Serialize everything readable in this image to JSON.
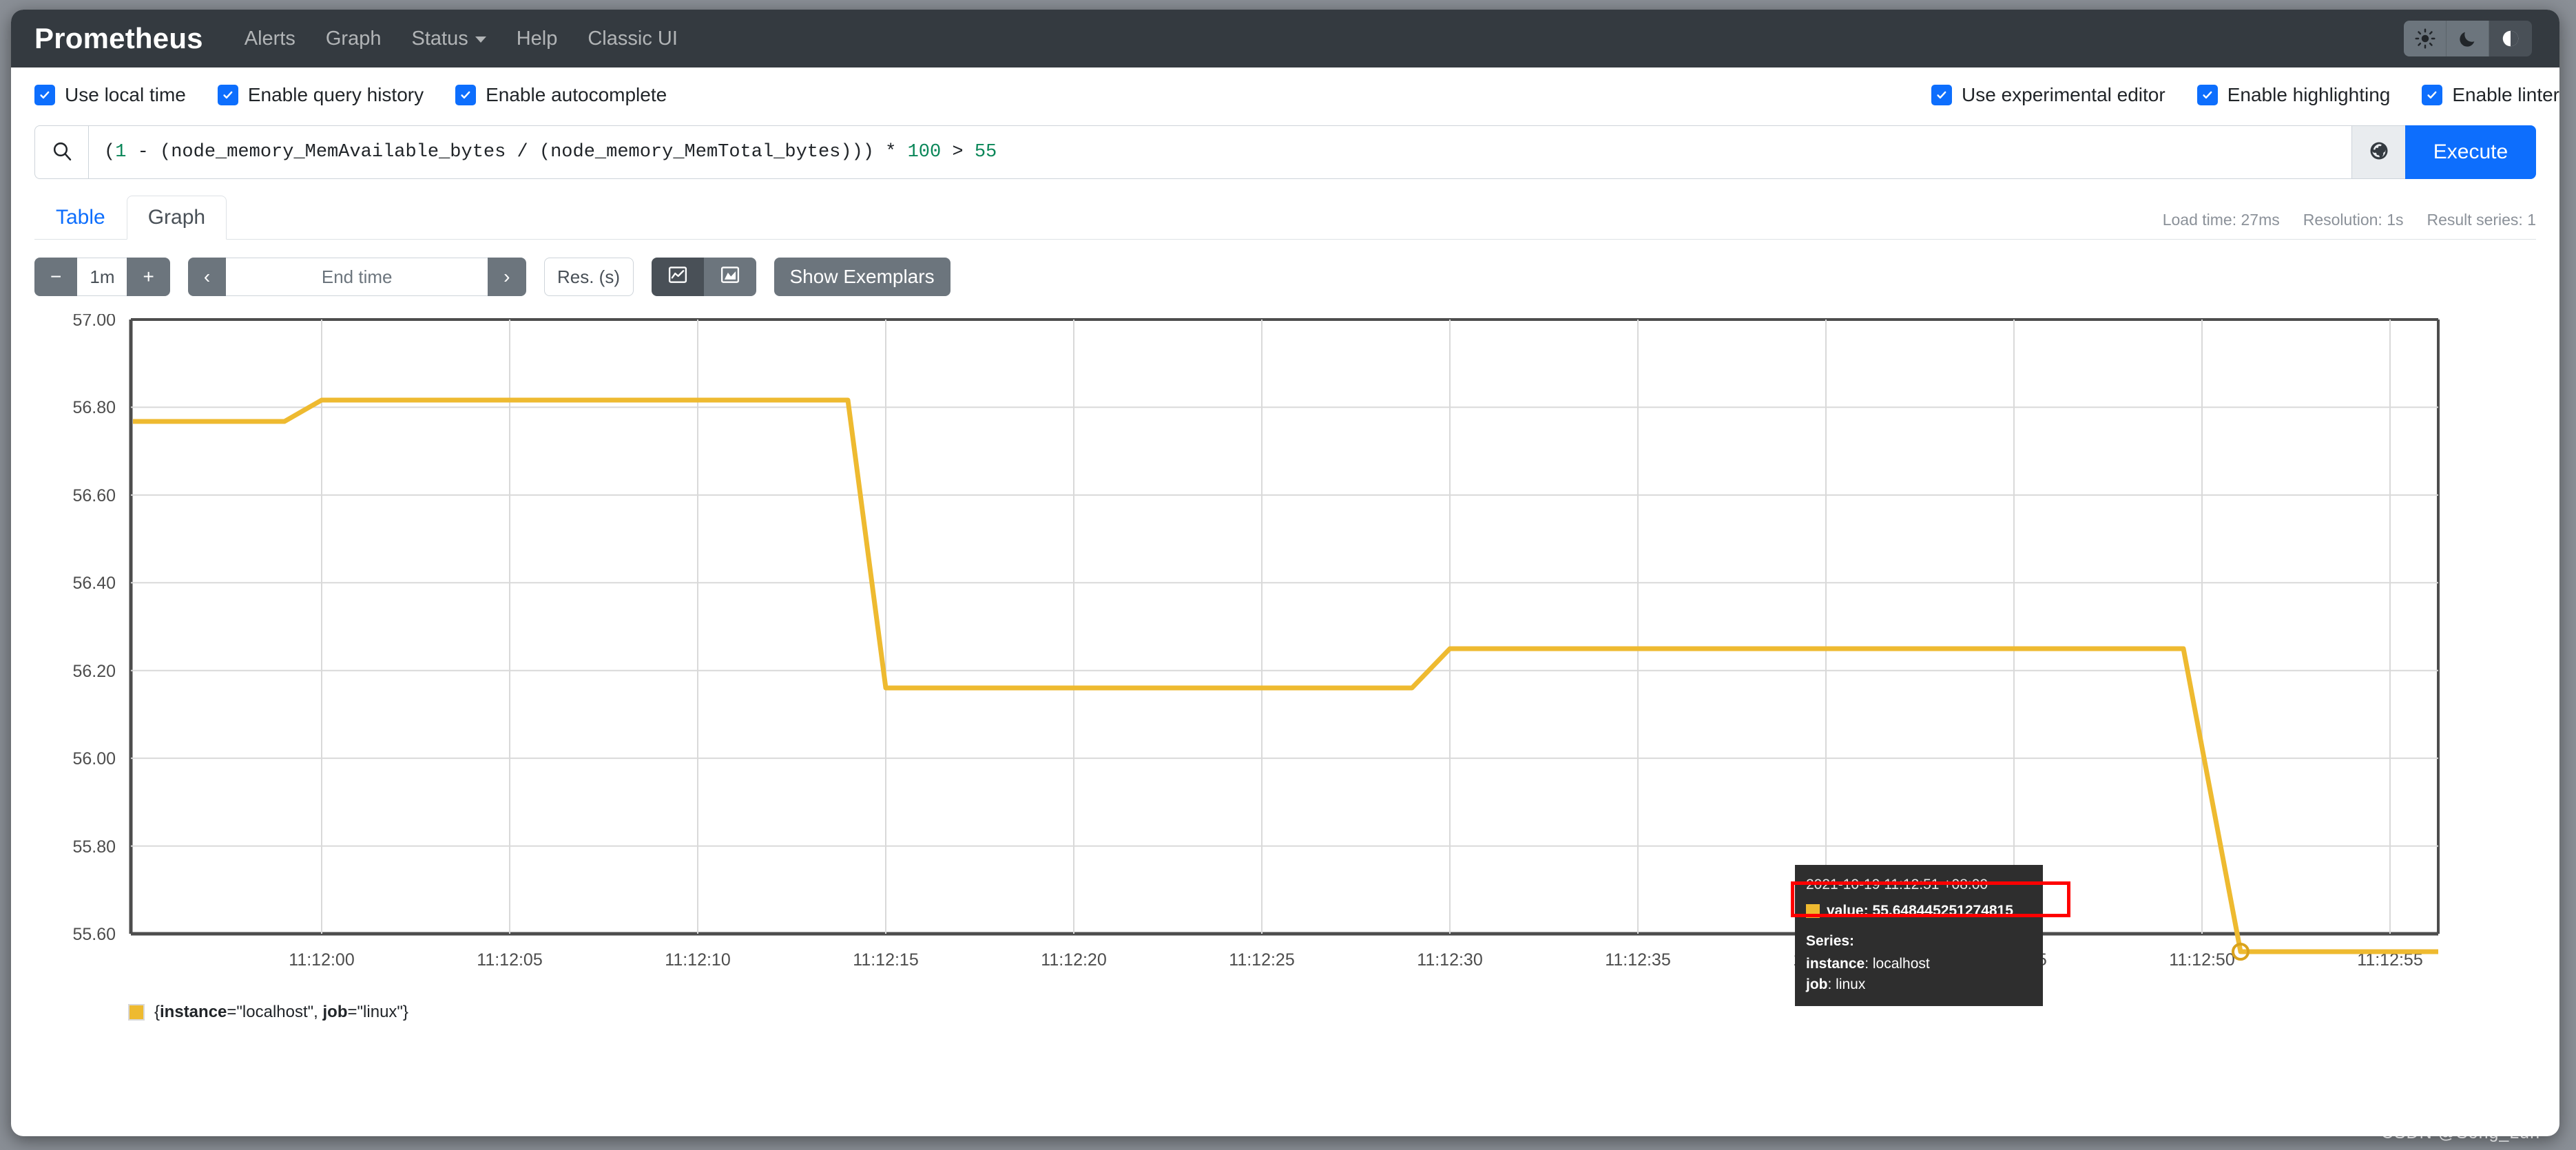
{
  "navbar": {
    "brand": "Prometheus",
    "links": [
      {
        "label": "Alerts",
        "name": "nav-alerts"
      },
      {
        "label": "Graph",
        "name": "nav-graph"
      },
      {
        "label": "Status",
        "name": "nav-status",
        "caret": true
      },
      {
        "label": "Help",
        "name": "nav-help"
      },
      {
        "label": "Classic UI",
        "name": "nav-classic-ui"
      }
    ],
    "theme_buttons": [
      {
        "icon": "sun-icon",
        "label": "Light theme"
      },
      {
        "icon": "moon-icon",
        "label": "Dark theme"
      },
      {
        "icon": "half-circle-icon",
        "label": "Auto theme",
        "active": true
      }
    ]
  },
  "settings": {
    "left": [
      {
        "label": "Use local time",
        "checked": true
      },
      {
        "label": "Enable query history",
        "checked": true
      },
      {
        "label": "Enable autocomplete",
        "checked": true
      }
    ],
    "right": [
      {
        "label": "Use experimental editor",
        "checked": true
      },
      {
        "label": "Enable highlighting",
        "checked": true
      },
      {
        "label": "Enable linter",
        "checked": true
      }
    ]
  },
  "query": {
    "search_icon": "search-icon",
    "history_icon": "globe-history-icon",
    "expression_parts": [
      {
        "t": "(",
        "k": "plain"
      },
      {
        "t": "1",
        "k": "num"
      },
      {
        "t": " - (node_memory_MemAvailable_bytes / (node_memory_MemTotal_bytes))) * ",
        "k": "plain"
      },
      {
        "t": "100",
        "k": "num"
      },
      {
        "t": " > ",
        "k": "plain"
      },
      {
        "t": "55",
        "k": "num"
      }
    ],
    "expression": "(1 - (node_memory_MemAvailable_bytes / (node_memory_MemTotal_bytes))) * 100 > 55",
    "execute_label": "Execute"
  },
  "tabs": [
    {
      "label": "Table",
      "active": false
    },
    {
      "label": "Graph",
      "active": true
    }
  ],
  "stats": [
    "Load time: 27ms",
    "Resolution: 1s",
    "Result series: 1"
  ],
  "controls": {
    "decrease_label": "−",
    "range_value": "1m",
    "increase_label": "+",
    "prev_label": "‹",
    "end_time_placeholder": "End time",
    "end_time_value": "",
    "next_label": "›",
    "resolution_placeholder": "Res. (s)",
    "resolution_value": "",
    "chart_type_line_icon": "line-chart-icon",
    "chart_type_stacked_icon": "stacked-area-icon",
    "show_exemplars_label": "Show Exemplars"
  },
  "legend": {
    "swatch_color": "#eeba30",
    "prefix": "{",
    "key1": "instance",
    "val1": "=\"localhost\", ",
    "key2": "job",
    "val2": "=\"linux\"}",
    "full": "{instance=\"localhost\", job=\"linux\"}"
  },
  "tooltip": {
    "timestamp": "2021-10-19 11:12:51 +08:00",
    "value_label": "value: 55.648445251274815",
    "series_header": "Series:",
    "instance_key": "instance",
    "instance_val": ": localhost",
    "job_key": "job",
    "job_val": ": linux",
    "swatch_color": "#eeba30",
    "highlight_color": "#ff0000"
  },
  "watermark": "CSDN @Song_Lun",
  "chart_data": {
    "type": "line",
    "title": "",
    "xlabel": "",
    "ylabel": "",
    "series_name": "{instance=\"localhost\", job=\"linux\"}",
    "color": "#eeba30",
    "grid": true,
    "legend_position": "bottom-left",
    "ylim": [
      55.6,
      57.0
    ],
    "yticks": [
      "55.60",
      "55.80",
      "56.00",
      "56.20",
      "56.40",
      "56.60",
      "56.80",
      "57.00"
    ],
    "ytick_values": [
      55.6,
      55.8,
      56.0,
      56.2,
      56.4,
      56.6,
      56.8,
      57.0
    ],
    "xlim": [
      "11:11:56",
      "11:12:56"
    ],
    "xticks": [
      "11:12:00",
      "11:12:05",
      "11:12:10",
      "11:12:15",
      "11:12:20",
      "11:12:25",
      "11:12:30",
      "11:12:35",
      "11:12:40",
      "11:12:45",
      "11:12:50",
      "11:12:55"
    ],
    "x": [
      "11:11:56",
      "11:11:59",
      "11:12:00",
      "11:12:14",
      "11:12:15",
      "11:12:29",
      "11:12:30",
      "11:12:49",
      "11:12:51",
      "11:12:56"
    ],
    "values": [
      56.755,
      56.755,
      56.8,
      56.8,
      56.145,
      56.145,
      56.235,
      56.235,
      55.648,
      55.648
    ],
    "highlighted_point": {
      "x": "11:12:51",
      "y": 55.648445251274815
    }
  }
}
